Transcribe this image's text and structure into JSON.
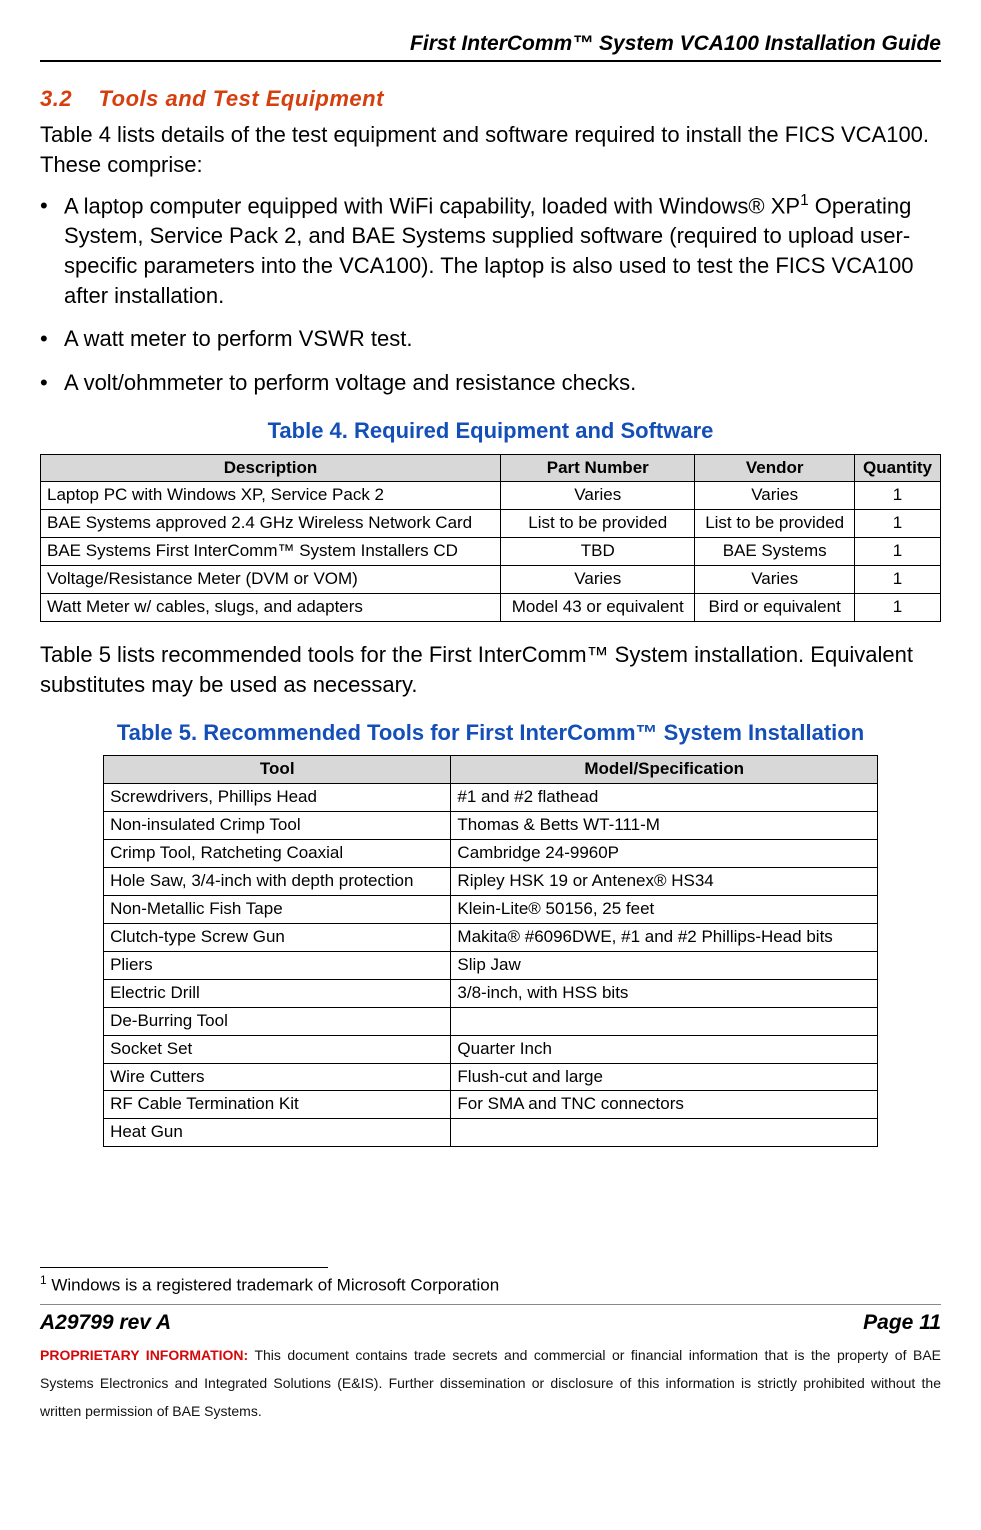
{
  "header_title": "First InterComm™ System VCA100  Installation Guide",
  "section": {
    "number": "3.2",
    "title": "Tools and Test Equipment"
  },
  "intro": "Table 4 lists details of the test equipment and software required to install the FICS VCA100.  These comprise:",
  "bullets": [
    {
      "pre": "A laptop computer equipped with WiFi capability, loaded with Windows® XP",
      "sup": "1",
      "post": " Operating System, Service Pack 2, and BAE Systems supplied software (required to upload user-specific parameters into the VCA100).  The laptop is also used to test the FICS VCA100 after installation."
    },
    {
      "pre": "A watt meter to perform VSWR test.",
      "sup": "",
      "post": ""
    },
    {
      "pre": "A volt/ohmmeter to perform voltage and resistance checks.",
      "sup": "",
      "post": ""
    }
  ],
  "table4": {
    "title": "Table 4.  Required Equipment and Software",
    "headers": [
      "Description",
      "Part Number",
      "Vendor",
      "Quantity"
    ],
    "rows": [
      [
        "Laptop PC with Windows XP, Service Pack 2",
        "Varies",
        "Varies",
        "1"
      ],
      [
        "BAE Systems approved 2.4 GHz Wireless Network Card",
        "List to be provided",
        "List to be provided",
        "1"
      ],
      [
        "BAE Systems First InterComm™  System Installers CD",
        "TBD",
        "BAE Systems",
        "1"
      ],
      [
        "Voltage/Resistance Meter (DVM or VOM)",
        "Varies",
        "Varies",
        "1"
      ],
      [
        "Watt Meter w/ cables, slugs, and adapters",
        "Model 43 or equivalent",
        "Bird or equivalent",
        "1"
      ]
    ]
  },
  "para_between": "Table 5 lists recommended tools for the First InterComm™  System installation.  Equivalent substitutes may be used as necessary.",
  "table5": {
    "title": "Table 5.  Recommended Tools for First InterComm™  System Installation",
    "headers": [
      "Tool",
      "Model/Specification"
    ],
    "rows": [
      [
        "Screwdrivers, Phillips Head",
        "#1 and #2 flathead"
      ],
      [
        "Non-insulated Crimp Tool",
        "Thomas & Betts WT-111-M"
      ],
      [
        "Crimp Tool, Ratcheting Coaxial",
        "Cambridge 24-9960P"
      ],
      [
        "Hole Saw, 3/4-inch with depth protection",
        "Ripley HSK 19 or Antenex® HS34"
      ],
      [
        "Non-Metallic Fish Tape",
        "Klein-Lite® 50156, 25 feet"
      ],
      [
        "Clutch-type Screw Gun",
        "Makita® #6096DWE, #1 and #2 Phillips-Head bits"
      ],
      [
        "Pliers",
        "Slip Jaw"
      ],
      [
        "Electric Drill",
        "3/8-inch, with HSS bits"
      ],
      [
        "De-Burring Tool",
        ""
      ],
      [
        "Socket Set",
        "Quarter Inch"
      ],
      [
        "Wire Cutters",
        "Flush-cut and large"
      ],
      [
        "RF Cable Termination Kit",
        "For SMA and TNC connectors"
      ],
      [
        "Heat Gun",
        ""
      ]
    ]
  },
  "footnote": {
    "marker": "1",
    "text": " Windows is a registered trademark of Microsoft Corporation"
  },
  "footer": {
    "doc_rev": "A29799 rev A",
    "page": "Page 11",
    "proprietary_label": "PROPRIETARY INFORMATION:",
    "proprietary_text": "  This document contains trade secrets and commercial or financial information that is the property of BAE Systems Electronics and Integrated Solutions (E&IS).  Further dissemination or disclosure of this information is strictly prohibited without the written permission of BAE Systems."
  }
}
